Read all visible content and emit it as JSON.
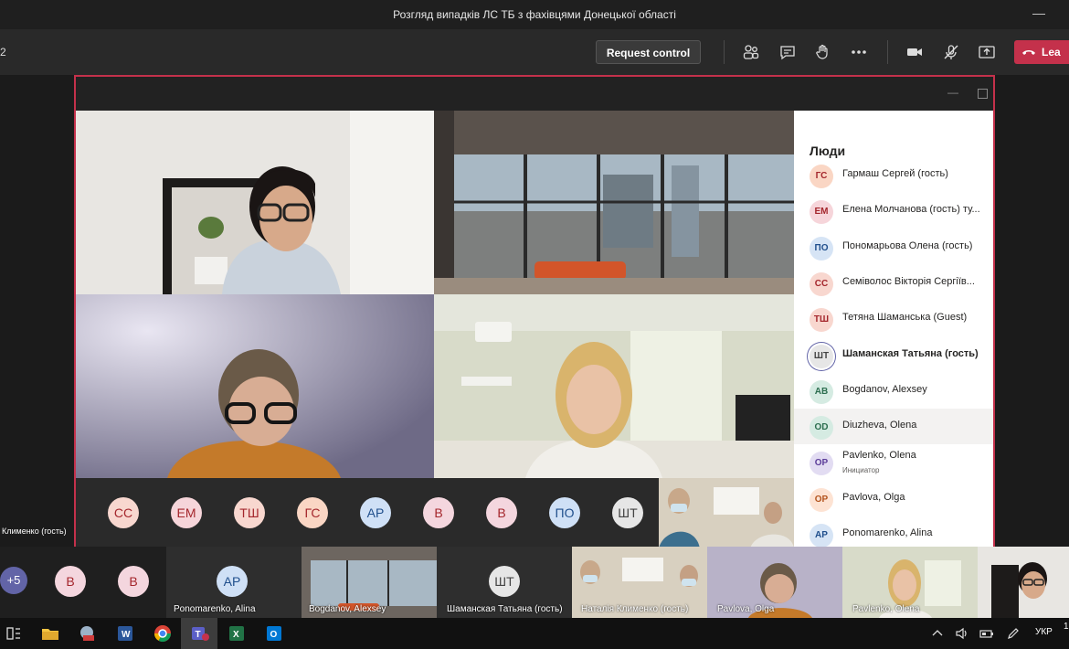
{
  "window": {
    "title": "Розгляд випадків ЛС ТБ з фахівцями Донецької області",
    "minimize": "—"
  },
  "toolbar": {
    "left_text": "2",
    "request_control": "Request control",
    "leave_label": "Lea",
    "icons": [
      "participants-icon",
      "chat-icon",
      "raise-hand-icon",
      "more-icon",
      "camera-icon",
      "mic-muted-icon",
      "share-icon"
    ]
  },
  "share": {
    "min": "—",
    "bottom_avatars": [
      {
        "initials": "СС",
        "bg": "#f8d7cf",
        "fg": "#a4262c"
      },
      {
        "initials": "ЕМ",
        "bg": "#f6d5da",
        "fg": "#a4262c"
      },
      {
        "initials": "ТШ",
        "bg": "#f8d7cf",
        "fg": "#a4262c"
      },
      {
        "initials": "ГС",
        "bg": "#fad6c4",
        "fg": "#a4262c"
      },
      {
        "initials": "АР",
        "bg": "#cfe0f6",
        "fg": "#1f4e8c"
      },
      {
        "initials": "В",
        "bg": "#f4d6de",
        "fg": "#a4262c"
      },
      {
        "initials": "В",
        "bg": "#f4d6de",
        "fg": "#a4262c"
      },
      {
        "initials": "ПО",
        "bg": "#cfe0f6",
        "fg": "#1f4e8c"
      },
      {
        "initials": "ШТ",
        "bg": "#e6e6e6",
        "fg": "#444"
      }
    ]
  },
  "people": {
    "header": "Люди",
    "rows": [
      {
        "initials": "ГС",
        "name": "Гармаш Сергей (гость)",
        "sub": "",
        "bg": "#fad6c4",
        "fg": "#a4262c",
        "bold": false,
        "hl": false
      },
      {
        "initials": "ЕМ",
        "name": "Елена Молчанова (гость) ту...",
        "sub": "",
        "bg": "#f6d5da",
        "fg": "#a4262c",
        "bold": false,
        "hl": false
      },
      {
        "initials": "ПО",
        "name": "Пономарьова Олена (гость)",
        "sub": "",
        "bg": "#d6e4f5",
        "fg": "#1f4e8c",
        "bold": false,
        "hl": false
      },
      {
        "initials": "СС",
        "name": "Семіволос Вікторія Сергіїв...",
        "sub": "",
        "bg": "#f8d7cf",
        "fg": "#a4262c",
        "bold": false,
        "hl": false
      },
      {
        "initials": "ТШ",
        "name": "Тетяна Шаманська (Guest)",
        "sub": "",
        "bg": "#f8d7cf",
        "fg": "#a4262c",
        "bold": false,
        "hl": false
      },
      {
        "initials": "ШТ",
        "name": "Шаманская Татьяна (гость)",
        "sub": "",
        "bg": "#e6e6e6",
        "fg": "#444444",
        "bold": true,
        "hl": false
      },
      {
        "initials": "AB",
        "name": "Bogdanov, Alexsey",
        "sub": "",
        "bg": "#d5ebe2",
        "fg": "#2b6e4f",
        "bold": false,
        "hl": false
      },
      {
        "initials": "OD",
        "name": "Diuzheva, Olena",
        "sub": "",
        "bg": "#d5ebe2",
        "fg": "#2b6e4f",
        "bold": false,
        "hl": true
      },
      {
        "initials": "OP",
        "name": "Pavlenko, Olena",
        "sub": "Инициатор",
        "bg": "#e2dcf2",
        "fg": "#5c3d99",
        "bold": false,
        "hl": false
      },
      {
        "initials": "OP",
        "name": "Pavlova, Olga",
        "sub": "",
        "bg": "#fde3d3",
        "fg": "#b3541e",
        "bold": false,
        "hl": false
      },
      {
        "initials": "AP",
        "name": "Ponomarenko, Alina",
        "sub": "",
        "bg": "#d6e4f5",
        "fg": "#1f4e8c",
        "bold": false,
        "hl": false
      }
    ]
  },
  "name_overlay": "Клименко (гость)",
  "tiles": {
    "plus": "+5",
    "v1": "В",
    "v2": "В",
    "ap_initials": "AP",
    "ap_label": "Ponomarenko, Alina",
    "bogdanov_label": "Bogdanov, Alexsey",
    "sht_initials": "ШТ",
    "sht_label": "Шаманская Татьяна (гость)",
    "klymenko_label": "Наталія Клименко (гость)",
    "pavlova_label": "Pavlova, Olga",
    "pavlenko_label": "Pavlenko, Olena"
  },
  "taskbar": {
    "lang": "УКР",
    "clock": "1"
  }
}
